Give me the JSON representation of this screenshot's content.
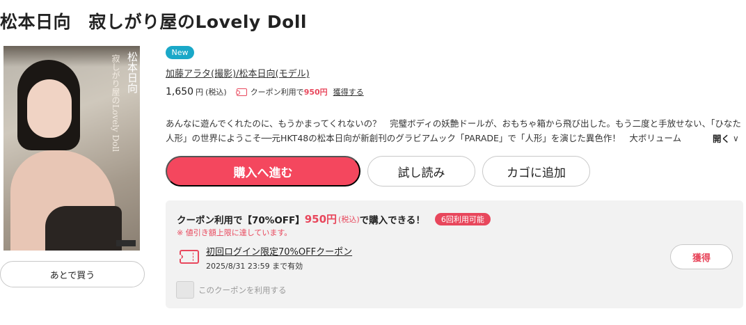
{
  "product": {
    "title": "松本日向　寂しがり屋のLovely Doll",
    "new_badge": "New",
    "authors": "加藤アラタ(撮影)/松本日向(モデル)",
    "price": "1,650",
    "price_unit": "円",
    "tax_label": "(税込)",
    "coupon_label": "クーポン利用で",
    "coupon_price": "950円",
    "get_label": "獲得する",
    "description": "あんなに遊んでくれたのに、もうかまってくれないの？　完璧ボディの妖艶ドールが、おもちゃ箱から飛び出した。もう二度と手放せない、「ひなた人形」の世界にようこそ──元HKT48の松本日向が新創刊のグラビアムック「PARADE」で「人形」を演じた異色作！　大ボリューム",
    "open_more": "開く",
    "cover": {
      "title_vertical": "松本日向",
      "subtitle_vertical": "寂しがり屋のLovely Doll"
    }
  },
  "actions": {
    "later": "あとで買う",
    "buy": "購入へ進む",
    "trial": "試し読み",
    "cart": "カゴに追加"
  },
  "coupon": {
    "head_prefix": "クーポン利用で【70%OFF】",
    "head_price": "950円",
    "head_tax": "(税込)",
    "head_suffix": "で購入できる！",
    "count_badge": "6回利用可能",
    "warning": "※ 値引き額上限に達しています。",
    "name": "初回ログイン限定70%OFFクーポン",
    "expiry": "2025/8/31 23:59 まで有効",
    "get_button": "獲得",
    "checkbox_label": "このクーポンを利用する"
  },
  "colors": {
    "accent": "#f4475e",
    "new_badge": "#1aa8c8",
    "coupon_box_bg": "#f2f2f2"
  }
}
